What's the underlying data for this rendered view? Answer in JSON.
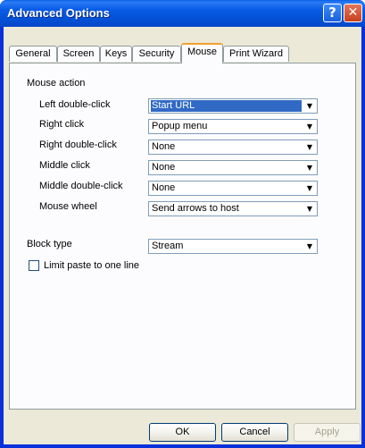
{
  "window": {
    "title": "Advanced Options"
  },
  "title_buttons": {
    "help_glyph": "?",
    "close_glyph": "✕"
  },
  "tabs": [
    {
      "label": "General"
    },
    {
      "label": "Screen"
    },
    {
      "label": "Keys"
    },
    {
      "label": "Security"
    },
    {
      "label": "Mouse",
      "active": true
    },
    {
      "label": "Print Wizard"
    }
  ],
  "mouse_action": {
    "heading": "Mouse action",
    "rows": [
      {
        "label": "Left double-click",
        "value": "Start URL",
        "selected": true
      },
      {
        "label": "Right click",
        "value": "Popup menu"
      },
      {
        "label": "Right double-click",
        "value": "None"
      },
      {
        "label": "Middle click",
        "value": "None"
      },
      {
        "label": "Middle double-click",
        "value": "None"
      },
      {
        "label": "Mouse wheel",
        "value": "Send arrows to host"
      }
    ]
  },
  "block_type": {
    "label": "Block type",
    "value": "Stream"
  },
  "limit_paste": {
    "label": "Limit paste to one line",
    "checked": false
  },
  "buttons": {
    "ok": "OK",
    "cancel": "Cancel",
    "apply": "Apply"
  },
  "icons": {
    "dropdown": "▼"
  },
  "colors": {
    "selection": "#316ac5",
    "titlebar": "#0451d6",
    "face": "#ece9d8"
  }
}
